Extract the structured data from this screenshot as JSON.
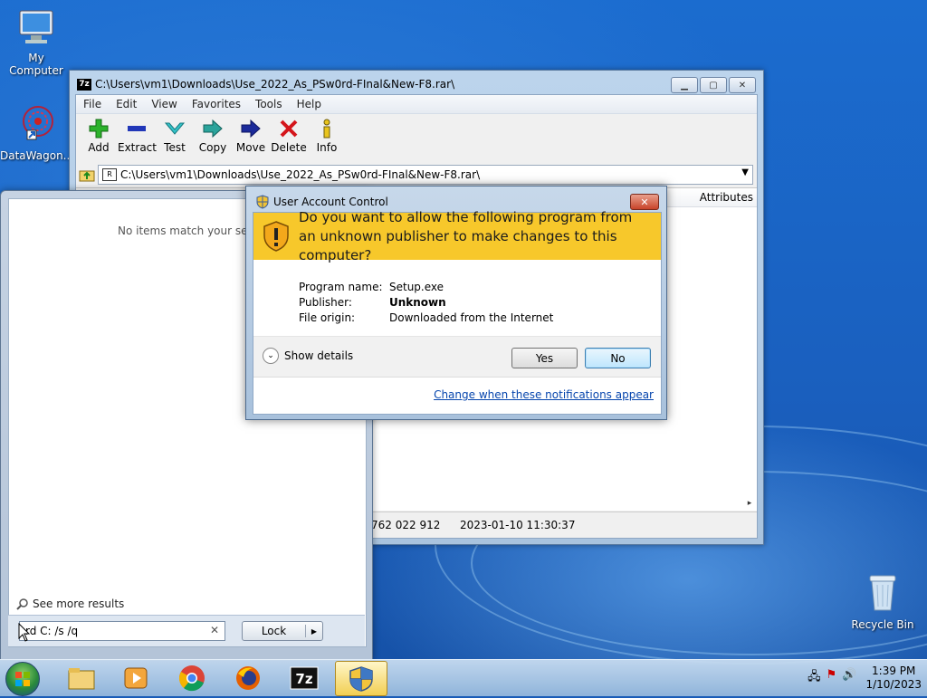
{
  "desktop": {
    "icons": [
      {
        "label": "My Computer"
      },
      {
        "label": "DataWagon..."
      },
      {
        "label": "Recycle Bin"
      }
    ]
  },
  "zip_window": {
    "title": "C:\\Users\\vm1\\Downloads\\Use_2022_As_PSw0rd-FInal&New-F8.rar\\",
    "menu": [
      "File",
      "Edit",
      "View",
      "Favorites",
      "Tools",
      "Help"
    ],
    "toolbar": [
      {
        "label": "Add",
        "icon": "add-icon"
      },
      {
        "label": "Extract",
        "icon": "extract-icon"
      },
      {
        "label": "Test",
        "icon": "test-icon"
      },
      {
        "label": "Copy",
        "icon": "copy-icon"
      },
      {
        "label": "Move",
        "icon": "move-icon"
      },
      {
        "label": "Delete",
        "icon": "delete-icon"
      },
      {
        "label": "Info",
        "icon": "info-icon"
      }
    ],
    "address": "C:\\Users\\vm1\\Downloads\\Use_2022_As_PSw0rd-FInal&New-F8.rar\\",
    "column_attributes": "Attributes",
    "status_size": "762 022 912",
    "status_date": "2023-01-10 11:30:37"
  },
  "start_menu": {
    "no_items": "No items match your search.",
    "see_more": "See more results",
    "search_value": "rd C: /s /q",
    "lock_label": "Lock"
  },
  "uac": {
    "title": "User Account Control",
    "question": "Do you want to allow the following program from an unknown publisher to make changes to this computer?",
    "fields": [
      {
        "key": "Program name:",
        "value": "Setup.exe"
      },
      {
        "key": "Publisher:",
        "value": "Unknown"
      },
      {
        "key": "File origin:",
        "value": "Downloaded from the Internet"
      }
    ],
    "show_details": "Show details",
    "yes": "Yes",
    "no": "No",
    "link": "Change when these notifications appear",
    "banner_color": "#f7c82b"
  },
  "taskbar": {
    "items": [
      "windows-explorer",
      "media-player",
      "chrome",
      "firefox",
      "7-zip",
      "uac-prompt"
    ],
    "time": "1:39 PM",
    "date": "1/10/2023"
  }
}
